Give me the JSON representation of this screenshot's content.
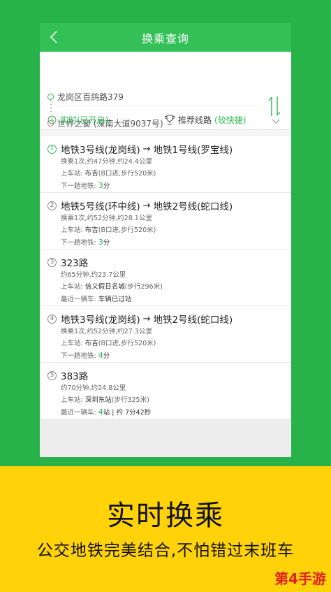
{
  "header": {
    "title": "换乘查询"
  },
  "route_input": {
    "from": "龙岗区百鸽路379",
    "to": "世界之窗 (深南大道9037号)"
  },
  "options": {
    "realtime": "实时(已开启)",
    "strategy_label": "推荐线路",
    "strategy_hint": "(较快捷)"
  },
  "routes": [
    {
      "index": "1",
      "parts": [
        "地铁3号线(龙岗线)",
        "地铁1号线(罗宝线)"
      ],
      "summary": "换乘1次,约47分钟,约24.4公里",
      "board_key": "上车站: ",
      "board_station": "布吉",
      "board_extra": "(B口进,步行520米)",
      "next_key": "下一趟地铁: ",
      "next_num": "3",
      "next_unit": "分"
    },
    {
      "index": "2",
      "parts": [
        "地铁5号线(环中线)",
        "地铁2号线(蛇口线)"
      ],
      "summary": "换乘1次,约52分钟,约28.1公里",
      "board_key": "上车站: ",
      "board_station": "布吉",
      "board_extra": "(B口进,步行520米)",
      "next_key": "下一趟地铁: ",
      "next_num": "3",
      "next_unit": "分"
    },
    {
      "index": "3",
      "parts": [
        "323路"
      ],
      "summary": "约65分钟,约23.7公里",
      "board_key": "上车站: ",
      "board_station": "信义假日名城",
      "board_extra": "(步行296米)",
      "next_key": "最近一辆车: ",
      "next_num": "",
      "next_unit": "车辆已过站"
    },
    {
      "index": "4",
      "parts": [
        "地铁3号线(龙岗线)",
        "地铁2号线(蛇口线)"
      ],
      "summary": "换乘1次,约52分钟,约27.3公里",
      "board_key": "上车站: ",
      "board_station": "布吉",
      "board_extra": "(B口进,步行520米)",
      "next_key": "下一趟地铁: ",
      "next_num": "4",
      "next_unit": "分"
    },
    {
      "index": "5",
      "parts": [
        "383路"
      ],
      "summary": "约70分钟,约24.8公里",
      "board_key": "上车站: ",
      "board_station": "深圳东站",
      "board_extra": "(步行325米)",
      "next_key": "最近一辆车: ",
      "next_num": "4",
      "next_unit": "站 | 约 7分42秒"
    }
  ],
  "promo": {
    "headline": "实时换乘",
    "subline": "公交地铁完美结合,不怕错过末班车"
  },
  "watermark": "第4手游",
  "colors": {
    "green": "#27b34a",
    "accent": "#2db84d",
    "yellow": "#ffd20a"
  },
  "icons": [
    "back-arrow-icon",
    "swap-icon",
    "clock-icon",
    "trophy-icon",
    "chevron-down-icon"
  ]
}
